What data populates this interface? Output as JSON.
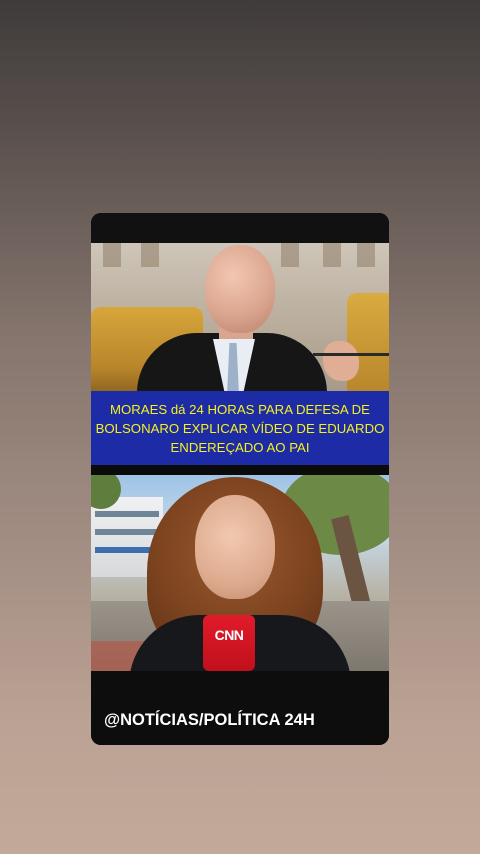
{
  "post": {
    "headline": "MORAES dá 24 HORAS PARA DEFESA DE BOLSONARO EXPLICAR VÍDEO DE EDUARDO ENDEREÇADO AO PAI",
    "handle": "@NOTÍCIAS/POLÍTICA 24H",
    "mic_flag_text": "CNN"
  },
  "colors": {
    "headline_bg": "#1d2ba6",
    "headline_text": "#f6f21c",
    "card_bg": "#0d0d0d",
    "mic_red": "#e11b2a"
  }
}
